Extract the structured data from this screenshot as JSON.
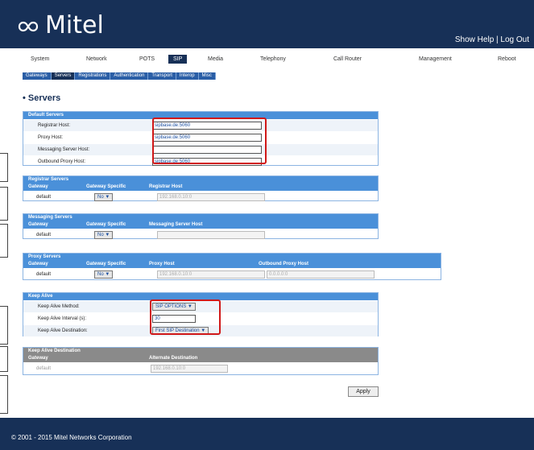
{
  "header": {
    "brand": "Mitel",
    "help_links": "Show Help | Log Out"
  },
  "main_nav": [
    {
      "label": "System"
    },
    {
      "label": "Network"
    },
    {
      "label": "POTS"
    },
    {
      "label": "SIP",
      "active": true
    },
    {
      "label": "Media"
    },
    {
      "label": "Telephony"
    },
    {
      "label": "Call Router"
    },
    {
      "label": "Management"
    },
    {
      "label": "Reboot"
    }
  ],
  "sub_nav": [
    {
      "label": "Gateways"
    },
    {
      "label": "Servers",
      "active": true
    },
    {
      "label": "Registrations"
    },
    {
      "label": "Authentication"
    },
    {
      "label": "Transport"
    },
    {
      "label": "Interop"
    },
    {
      "label": "Misc"
    }
  ],
  "page": {
    "title": "• Servers"
  },
  "default_servers": {
    "title": "Default Servers",
    "rows": [
      {
        "label": "Registrar Host:",
        "value": "sipbase.de:5060"
      },
      {
        "label": "Proxy Host:",
        "value": "sipbase.de:5060"
      },
      {
        "label": "Messaging Server Host:",
        "value": ""
      },
      {
        "label": "Outbound Proxy Host:",
        "value": "sipbase.de:5060"
      }
    ]
  },
  "registrar_servers": {
    "title": "Registrar Servers",
    "col1": "Gateway",
    "col2": "Gateway Specific",
    "col3": "Registrar Host",
    "row": {
      "gateway": "default",
      "specific": "No",
      "host": "192.168.0.10:0"
    }
  },
  "messaging_servers": {
    "title": "Messaging Servers",
    "col1": "Gateway",
    "col2": "Gateway Specific",
    "col3": "Messaging Server Host",
    "row": {
      "gateway": "default",
      "specific": "No",
      "host": ""
    }
  },
  "proxy_servers": {
    "title": "Proxy Servers",
    "col1": "Gateway",
    "col2": "Gateway Specific",
    "col3": "Proxy Host",
    "col4": "Outbound Proxy Host",
    "row": {
      "gateway": "default",
      "specific": "No",
      "host": "192.168.0.10:0",
      "outbound": "0.0.0.0:0"
    }
  },
  "keep_alive": {
    "title": "Keep Alive",
    "method_label": "Keep Alive Method:",
    "method_value": "SIP OPTIONS",
    "interval_label": "Keep Alive Interval (s):",
    "interval_value": "30",
    "dest_label": "Keep Alive Destination:",
    "dest_value": "First SIP Destination"
  },
  "keep_alive_destination": {
    "title": "Keep Alive Destination",
    "col1": "Gateway",
    "col2": "Alternate Destination",
    "row": {
      "gateway": "default",
      "dest": "192.168.0.10:0"
    }
  },
  "apply_label": "Apply",
  "footer": {
    "copyright": "© 2001 - 2015 Mitel Networks Corporation"
  }
}
